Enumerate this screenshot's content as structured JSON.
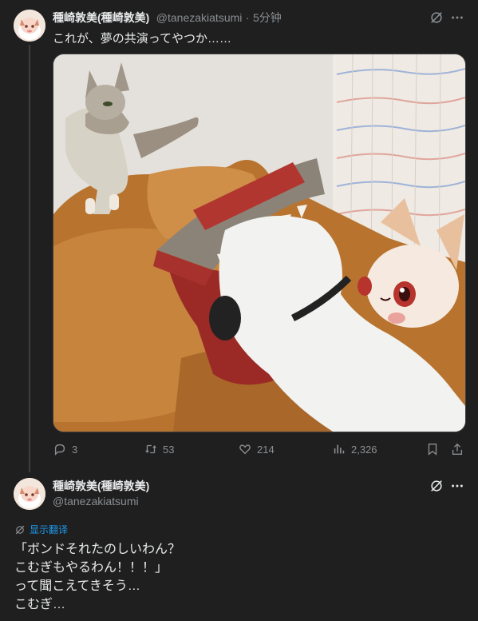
{
  "tweet": {
    "display_name": "種崎敦美(種崎敦美)",
    "handle": "@tanezakiatsumi",
    "separator": "·",
    "time": "5分钟",
    "text": "これが、夢の共演ってやつか……",
    "media_alt": "Cat on leather sofa next to plush toys",
    "stats": {
      "replies": "3",
      "reposts": "53",
      "likes": "214",
      "views": "2,326"
    }
  },
  "reply": {
    "display_name": "種崎敦美(種崎敦美)",
    "handle": "@tanezakiatsumi",
    "translate_label": "显示翻译",
    "lines": [
      "「ボンドそれたのしいわん？",
      "こむぎもやるわん！！！」",
      "って聞こえてきそう…",
      "こむぎ…"
    ]
  },
  "icons": {
    "grok": "grok-icon",
    "more": "more-icon",
    "reply": "reply-icon",
    "repost": "repost-icon",
    "like": "heart-icon",
    "views": "views-icon",
    "bookmark": "bookmark-icon",
    "share": "share-icon",
    "translate": "translate-icon"
  },
  "colors": {
    "background": "#1f1f1f",
    "accent": "#1d9bf0",
    "muted": "#8b8f93"
  }
}
